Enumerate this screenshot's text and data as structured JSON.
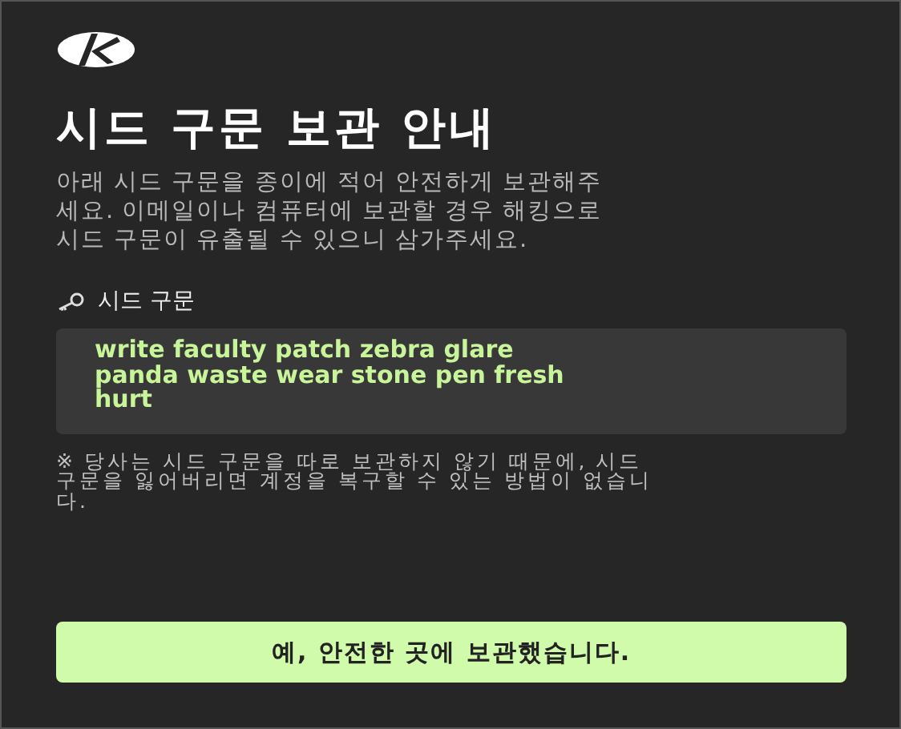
{
  "title": "시드 구문 보관 안내",
  "description": "아래 시드 구문을 종이에 적어 안전하게 보관해주\n세요. 이메일이나 컴퓨터에 보관할 경우 해킹으로\n시드 구문이 유출될 수 있으니 삼가주세요.",
  "seed_label": "시드 구문",
  "seed_phrase": "write faculty patch zebra glare\npanda waste wear stone pen fresh\nhurt",
  "notice": "※ 당사는 시드 구문을 따로 보관하지 않기 때문에, 시드\n구문을 잃어버리면 계정을 복구할 수 있는 방법이 없습니\n다.",
  "confirm_button": "예, 안전한 곳에 보관했습니다."
}
